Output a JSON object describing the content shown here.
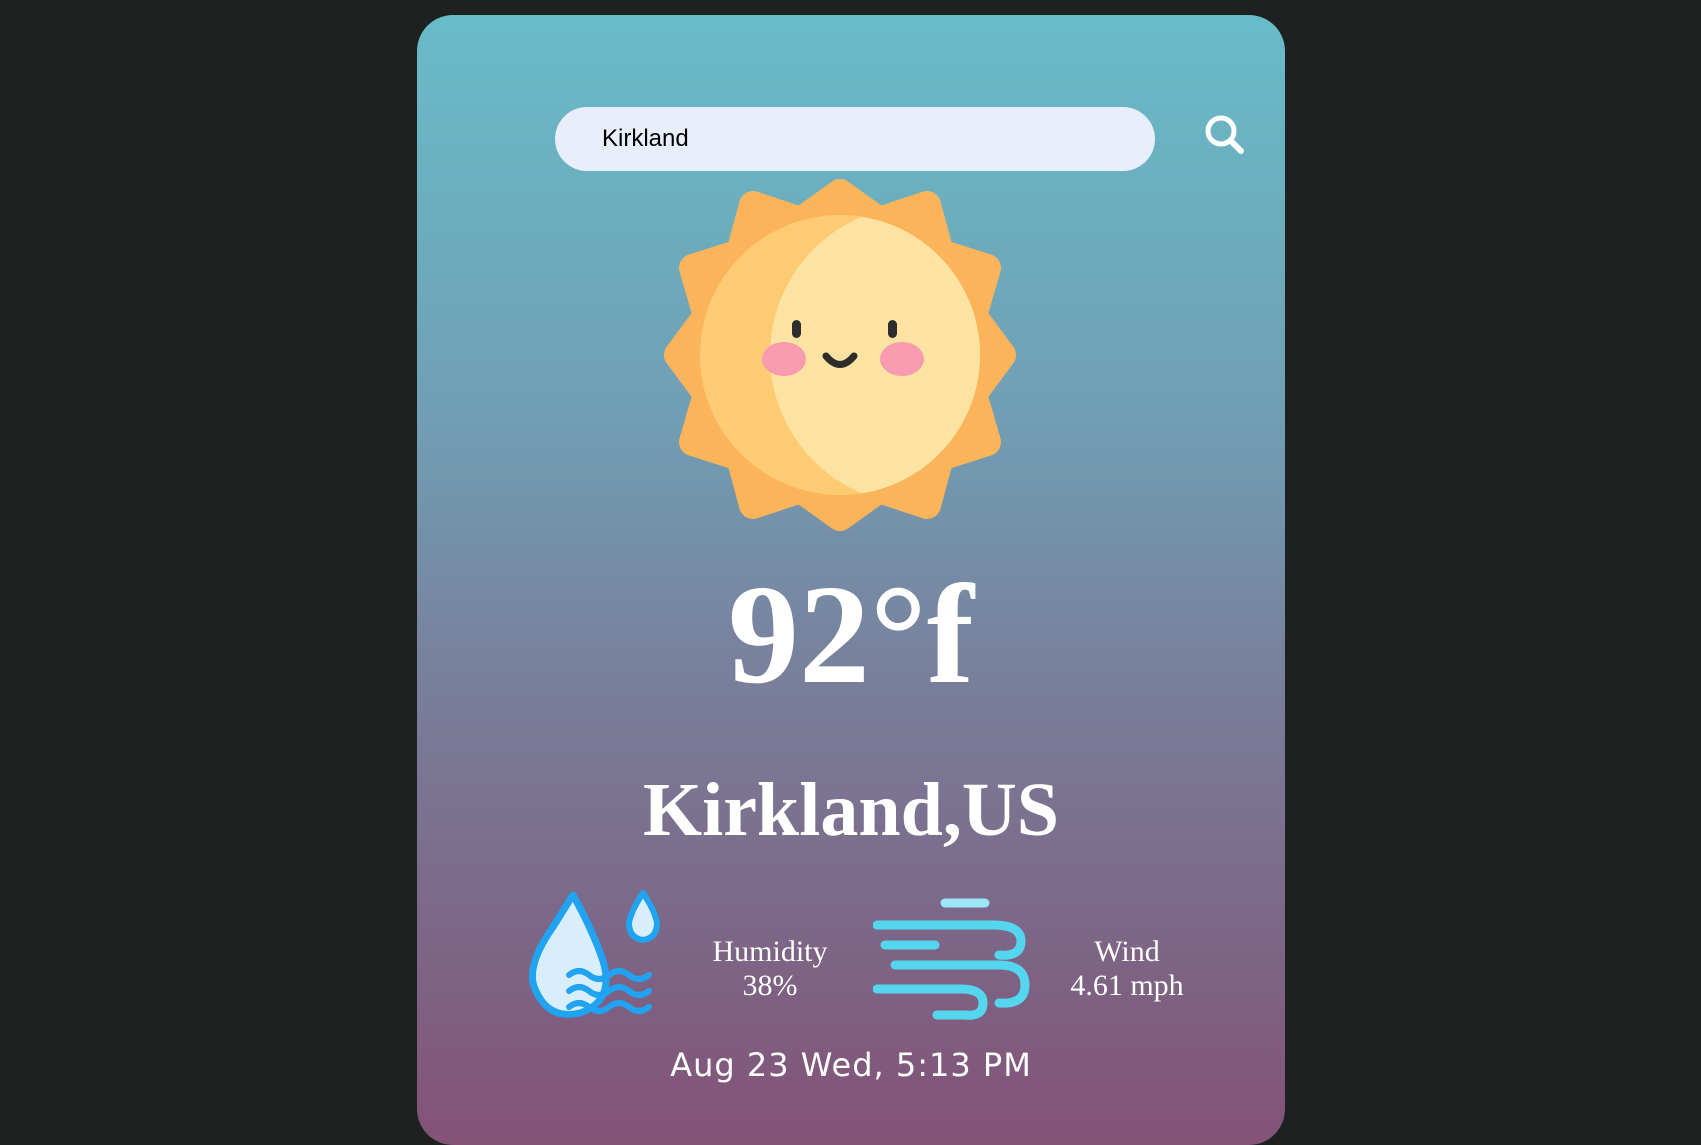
{
  "search": {
    "value": "Kirkland",
    "icon": "search-icon"
  },
  "weather": {
    "icon": "smiling-sun-icon",
    "temperature": "92°f",
    "location": "Kirkland,US"
  },
  "details": {
    "humidity": {
      "icon": "humidity-icon",
      "label": "Humidity",
      "value": "38%"
    },
    "wind": {
      "icon": "wind-icon",
      "label": "Wind",
      "value": "4.61 mph"
    }
  },
  "datetime": "Aug 23 Wed, 5:13 PM",
  "colors": {
    "background": "#1d2120",
    "card_top": "#68bcc8",
    "card_bottom": "#835277",
    "search_bg": "#e8eefb"
  }
}
